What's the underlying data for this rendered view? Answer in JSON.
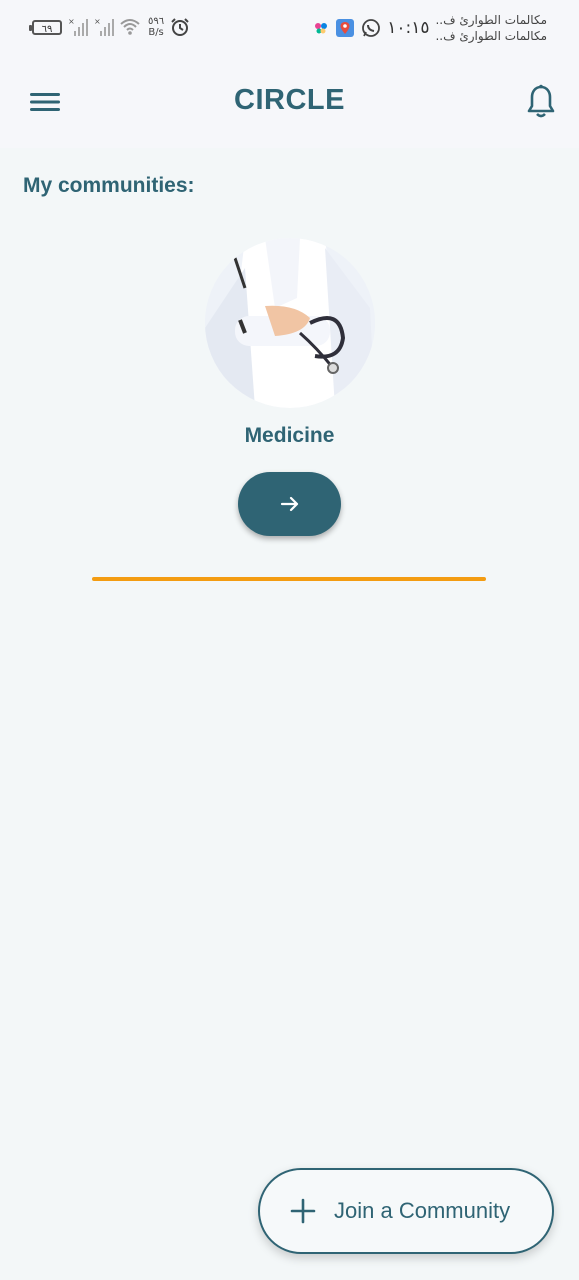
{
  "status_bar": {
    "battery": "٦٩",
    "speed_value": "٥٩٦",
    "speed_unit": "B/s",
    "time": "١٠:١٥",
    "notification_line1": "مكالمات الطوارئ ف..",
    "notification_line2": "مكالمات الطوارئ ف.."
  },
  "app_bar": {
    "title": "CIRCLE",
    "menu_icon": "hamburger-menu-icon",
    "bell_icon": "bell-icon"
  },
  "section": {
    "title": "My communities:"
  },
  "communities": [
    {
      "name": "Medicine",
      "image": "doctor-with-stethoscope-photo"
    }
  ],
  "fab": {
    "label": "Join a Community",
    "icon": "plus-icon"
  },
  "colors": {
    "primary": "#2f6474",
    "accent": "#f39c12",
    "background": "#f3f7f8"
  }
}
